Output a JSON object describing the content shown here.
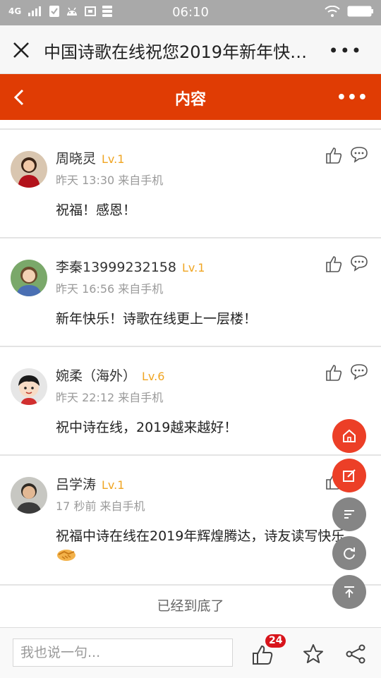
{
  "status_bar": {
    "network": "4G",
    "time": "06:10",
    "icons": [
      "signal-icon",
      "check-icon",
      "android-icon",
      "screenshot-icon",
      "storage-icon",
      "wifi-icon",
      "battery-icon"
    ]
  },
  "title_bar": {
    "title": "中国诗歌在线祝您2019年新年快…",
    "more": "•••"
  },
  "nav_bar": {
    "title": "内容",
    "more": "•••",
    "color": "#e03c04"
  },
  "comments": [
    {
      "user": "周晓灵",
      "level": "Lv.1",
      "time": "昨天 13:30 来自手机",
      "text": "祝福！感恩！"
    },
    {
      "user": "李秦13999232158",
      "level": "Lv.1",
      "time": "昨天 16:56 来自手机",
      "text": "新年快乐！诗歌在线更上一层楼！"
    },
    {
      "user": "婉柔（海外）",
      "level": "Lv.6",
      "time": "昨天 22:12 来自手机",
      "text": "祝中诗在线，2019越来越好！"
    },
    {
      "user": "吕学涛",
      "level": "Lv.1",
      "time": "17 秒前 来自手机",
      "text": "祝福中诗在线在2019年辉煌腾达，诗友读写快乐",
      "emoji": "handshake-icon"
    }
  ],
  "end_text": "已经到底了",
  "bottom_bar": {
    "placeholder": "我也说一句...",
    "like_count": "24"
  },
  "floating_buttons": [
    "home-icon",
    "edit-icon",
    "menu-icon",
    "refresh-icon",
    "to-top-icon"
  ],
  "colors": {
    "accent": "#e03c04",
    "level": "#f0a522",
    "badge": "#d8141b"
  }
}
